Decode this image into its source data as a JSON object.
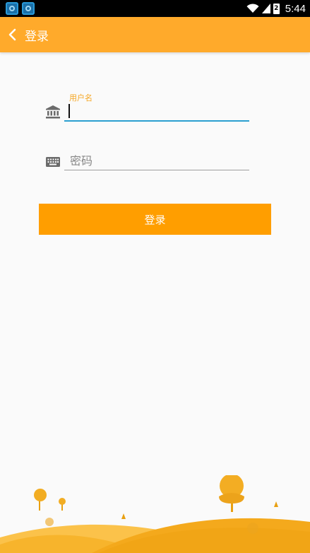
{
  "status_bar": {
    "time": "5:44",
    "battery_level": "2",
    "icons": [
      "app-notification-icon",
      "app-notification-icon",
      "wifi-icon",
      "cellular-signal-icon",
      "battery-icon"
    ]
  },
  "toolbar": {
    "back_icon": "chevron-left-icon",
    "title": "登录"
  },
  "form": {
    "username": {
      "icon": "bank-icon",
      "label": "用户名",
      "value": ""
    },
    "password": {
      "icon": "keyboard-icon",
      "placeholder": "密码"
    },
    "login_button": "登录"
  },
  "colors": {
    "toolbar": "#ffaa2b",
    "button": "#ff9e00",
    "accent": "#f5a623",
    "input_focus": "#2b9fd0",
    "background": "#fafafa"
  }
}
